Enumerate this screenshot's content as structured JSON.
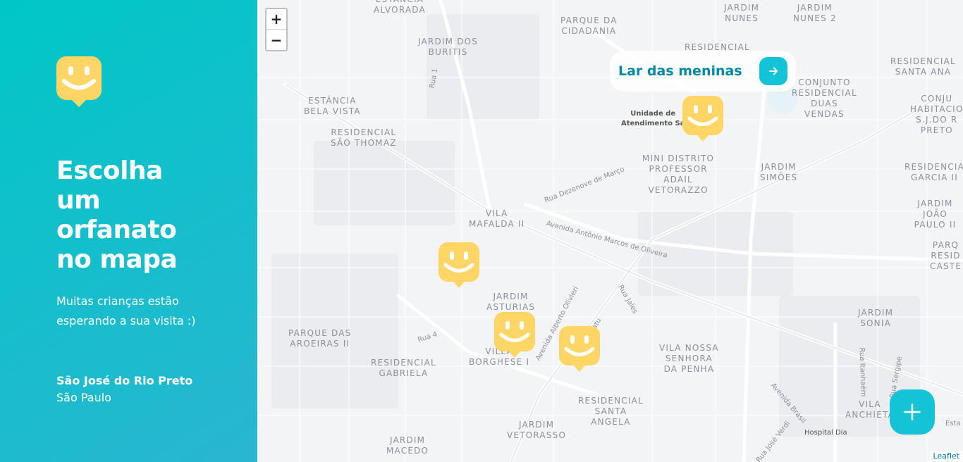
{
  "sidebar": {
    "heading": "Escolha um orfanato no mapa",
    "subtitle": "Muitas crianças estão esperando a sua visita :)",
    "city": "São José do Rio Preto",
    "state": "São Paulo"
  },
  "map": {
    "zoom_in": "+",
    "zoom_out": "−",
    "attribution": "Leaflet",
    "popup_label": "Lar das meninas",
    "districts": [
      "Estância\nAlvorada",
      "Parque da\nCidadania",
      "Jardim\nNunes",
      "Jardim\nNunes 2",
      "Jardim dos\nBuritis",
      "Residencial",
      "Conjunto\nResidencial\nDuas\nVendas",
      "Residencial\nSanta Ana",
      "Conju\nHabitacio\nS.J.do R\nPreto",
      "Estância\nBela Vista",
      "Residencial\nSão Thomaz",
      "Mini Distrito\nProfessor\nAdail\nVetorazzo",
      "Jardim\nSimões",
      "Residencia\nGarcia II",
      "Vila\nMafalda II",
      "Jardim João\nPaulo II",
      "Parq\nResid\nCaste",
      "Jardim\nAsturias",
      "Parque das\nAroeiras II",
      "Villa\nBorghese I",
      "Residencial\nGabriela",
      "Jardim\nSonia",
      "Vila Nossa\nSenhora\nda Penha",
      "Residencial\nSanta\nAngela",
      "Vila\nAnchieta",
      "Jardim\nVetorasso",
      "Jardim\nMacedo"
    ],
    "streets": [
      "Rua 1",
      "Rua Dezenove de Março",
      "Avenida Antônio Marcos de Oliveira",
      "Rua Jales",
      "Avenida Alberto Olivieri",
      "Rua 4",
      "Avenida Brasil",
      "Rua Itanhaém",
      "Rua Sergipe",
      "Rua José Verdi",
      "Esta",
      "Jatu"
    ],
    "pois": [
      "Unidade de\nAtendimento Sa",
      "Hospital Dia"
    ]
  },
  "colors": {
    "sidebar_start": "#29B6D1",
    "sidebar_end": "#00C7C7",
    "marker": "#FFD666",
    "accent": "#15C3D6",
    "popup_text": "#0089A5"
  },
  "icons": {
    "logo": "smiley-pin-icon",
    "marker": "smiley-pin-icon",
    "popup_go": "arrow-right-icon",
    "add": "plus-icon"
  }
}
